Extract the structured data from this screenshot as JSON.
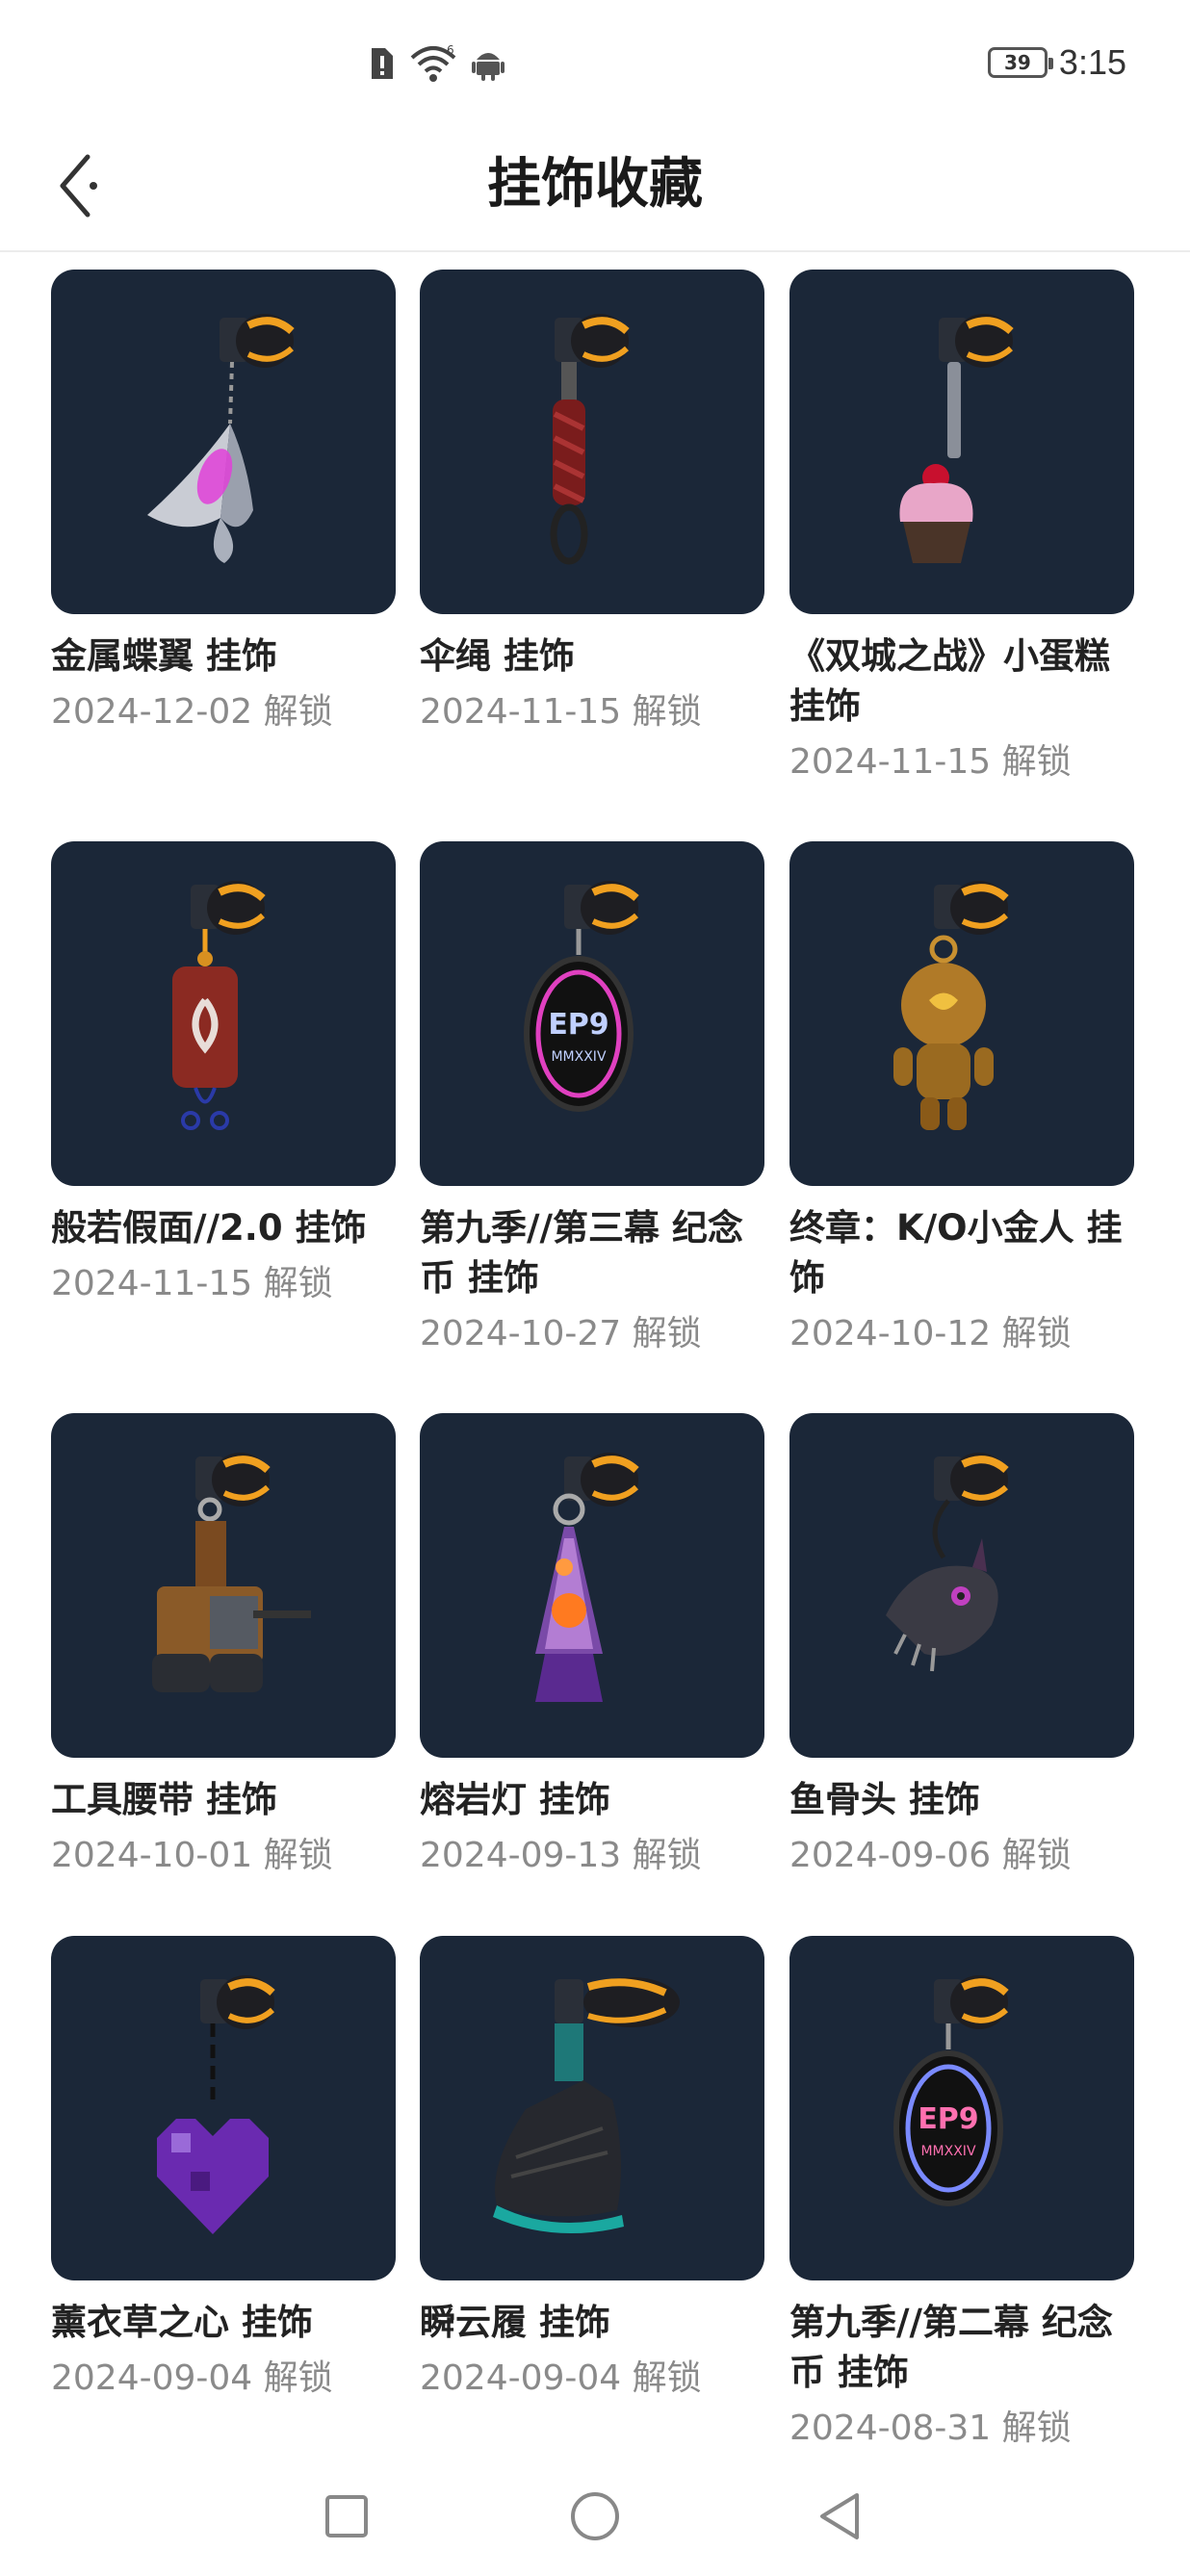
{
  "status_bar": {
    "icons": [
      "alert-sim-icon",
      "wifi-icon",
      "android-icon"
    ],
    "battery_level": "39",
    "time": "3:15"
  },
  "header": {
    "title": "挂饰收藏",
    "back_icon": "back-arrow-icon"
  },
  "colors": {
    "thumb_bg": "#1b2738",
    "accent_gold": "#f0a020",
    "text_primary": "#222222",
    "text_secondary": "#8a8a8a"
  },
  "items": [
    {
      "name": "金属蝶翼 挂饰",
      "date": "2024-12-02 解锁",
      "icon": "butterfly-charm-icon"
    },
    {
      "name": "伞绳 挂饰",
      "date": "2024-11-15 解锁",
      "icon": "paracord-charm-icon"
    },
    {
      "name": "《双城之战》小蛋糕挂饰",
      "date": "2024-11-15 解锁",
      "icon": "cupcake-charm-icon"
    },
    {
      "name": "般若假面//2.0 挂饰",
      "date": "2024-11-15 解锁",
      "icon": "lantern-charm-icon"
    },
    {
      "name": "第九季//第三幕 纪念币 挂饰",
      "date": "2024-10-27 解锁",
      "icon": "ep9-coin-charm-icon"
    },
    {
      "name": "终章：K/O小金人 挂饰",
      "date": "2024-10-12 解锁",
      "icon": "gold-robot-charm-icon"
    },
    {
      "name": "工具腰带 挂饰",
      "date": "2024-10-01 解锁",
      "icon": "tool-belt-charm-icon"
    },
    {
      "name": "熔岩灯 挂饰",
      "date": "2024-09-13 解锁",
      "icon": "lava-lamp-charm-icon"
    },
    {
      "name": "鱼骨头 挂饰",
      "date": "2024-09-06 解锁",
      "icon": "fish-bone-charm-icon"
    },
    {
      "name": "薰衣草之心 挂饰",
      "date": "2024-09-04 解锁",
      "icon": "lavender-heart-charm-icon"
    },
    {
      "name": "瞬云履 挂饰",
      "date": "2024-09-04 解锁",
      "icon": "shoe-charm-icon"
    },
    {
      "name": "第九季//第二幕 纪念币 挂饰",
      "date": "2024-08-31 解锁",
      "icon": "ep9-coin-charm-icon"
    }
  ],
  "coin_text": {
    "main": "EP9",
    "sub": "MMXXIV"
  },
  "navbar": {
    "buttons": [
      "recent-apps-icon",
      "home-icon",
      "back-triangle-icon"
    ]
  }
}
